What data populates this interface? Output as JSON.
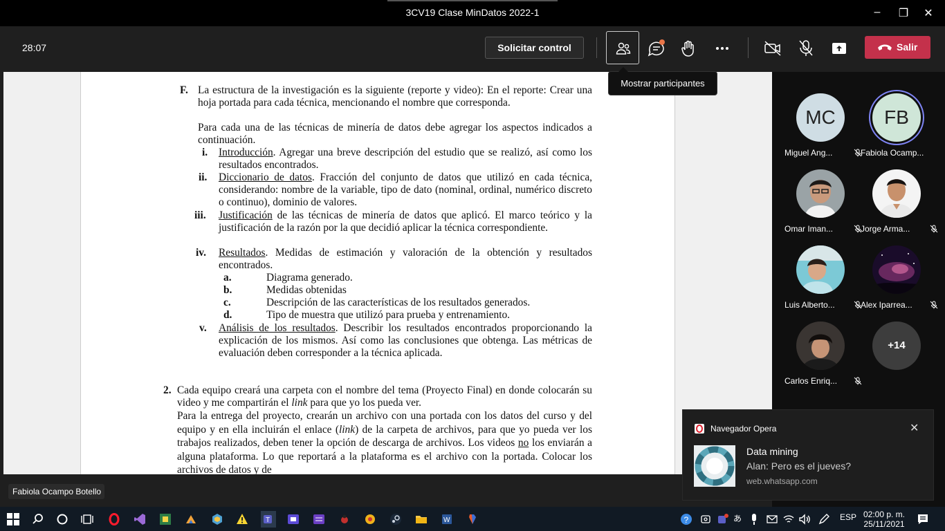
{
  "window": {
    "title": "3CV19 Clase MinDatos 2022-1",
    "controls": {
      "minimize": "–",
      "restore": "❐",
      "close": "✕"
    }
  },
  "toolbar": {
    "timer": "28:07",
    "request_control": "Solicitar control",
    "participants_tooltip": "Mostrar participantes",
    "leave": "Salir"
  },
  "document": {
    "F_label": "F.",
    "F_text1": "La estructura de la investigación es la siguiente (reporte y video): En el reporte: Crear una hoja portada para cada técnica, mencionando el nombre que corresponda.",
    "F_text2": "Para cada una de las técnicas de minería de datos debe agregar los aspectos indicados a continuación.",
    "items": [
      {
        "num": "i.",
        "title": "Introducción",
        "text": ". Agregar una breve descripción del estudio que se realizó, así como los resultados encontrados."
      },
      {
        "num": "ii.",
        "title": "Diccionario de datos",
        "text": ". Fracción del conjunto de datos que utilizó en cada técnica, considerando: nombre de la variable, tipo de dato (nominal, ordinal, numérico discreto o continuo), dominio de valores."
      },
      {
        "num": "iii.",
        "title": "Justificación",
        "text": " de las técnicas de minería de datos que aplicó. El marco teórico y la justificación de la razón por la que decidió aplicar la técnica correspondiente."
      },
      {
        "num": "iv.",
        "title": "Resultados",
        "text": ". Medidas de estimación y valoración de la obtención y resultados encontrados."
      },
      {
        "num": "v.",
        "title": "Análisis de los resultados",
        "text": ". Describir los resultados encontrados proporcionando la explicación de los mismos. Así como las conclusiones que obtenga. Las métricas de evaluación deben corresponder a la técnica aplicada."
      }
    ],
    "subitems": [
      {
        "num": "a.",
        "text": "Diagrama generado."
      },
      {
        "num": "b.",
        "text": "Medidas obtenidas"
      },
      {
        "num": "c.",
        "text": "Descripción de las características de los resultados generados."
      },
      {
        "num": "d.",
        "text": "Tipo de muestra que utilizó para prueba y entrenamiento."
      }
    ],
    "p2_num": "2.",
    "p2_text_a": "Cada equipo creará una carpeta con el nombre del tema (Proyecto Final) en donde colocarán su video y me compartirán el ",
    "p2_link1": "link",
    "p2_text_b": " para que yo los pueda ver.",
    "p2_text_c": "Para la entrega del proyecto, crearán un archivo con una portada con los datos del curso y del equipo y en ella incluirán el enlace (",
    "p2_link2": "link",
    "p2_text_d": ") de la carpeta de archivos, para que yo pueda ver los trabajos realizados, deben tener la opción de descarga de archivos. Los videos ",
    "p2_no": "no",
    "p2_text_e": " los enviarán a alguna plataforma. Lo que reportará a la plataforma es el archivo con la portada. Colocar los archivos de datos y de"
  },
  "presenter_name": "Fabiola Ocampo Botello",
  "participants": [
    {
      "name": "Miguel Ang...",
      "initials": "MC",
      "bg": "#cfdde4"
    },
    {
      "name": "Fabiola Ocamp...",
      "initials": "FB",
      "bg": "#cfe6d8"
    },
    {
      "name": "Omar Iman...",
      "initials": ""
    },
    {
      "name": "Jorge Arma...",
      "initials": ""
    },
    {
      "name": "Luis Alberto...",
      "initials": ""
    },
    {
      "name": "Alex Iparrea...",
      "initials": ""
    },
    {
      "name": "Carlos Enriq...",
      "initials": ""
    }
  ],
  "more_count": "+14",
  "notification": {
    "app": "Navegador Opera",
    "title": "Data mining",
    "message": "Alan: Pero es el jueves?",
    "source": "web.whatsapp.com",
    "close": "✕"
  },
  "taskbar": {
    "language": "ESP",
    "time": "02:00 p. m.",
    "date": "25/11/2021"
  },
  "colors": {
    "leave": "#c4314b",
    "accent_ring": "#7f85f5",
    "notification_dot": "#e97548"
  }
}
